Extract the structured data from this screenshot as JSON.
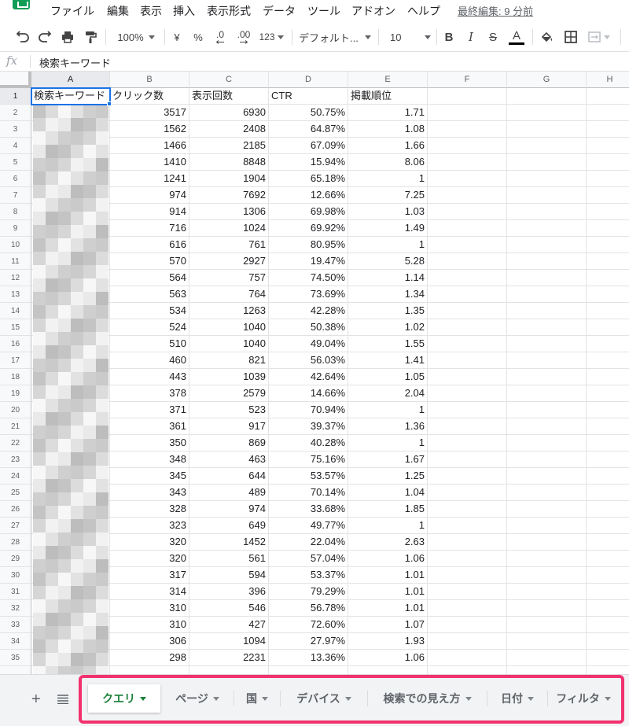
{
  "menu": {
    "items": [
      "ファイル",
      "編集",
      "表示",
      "挿入",
      "表示形式",
      "データ",
      "ツール",
      "アドオン",
      "ヘルプ"
    ],
    "last_edit": "最終編集: 9 分前"
  },
  "toolbar": {
    "zoom": "100%",
    "currency": "¥",
    "percent": "%",
    "decrease_decimal": ".0",
    "increase_decimal": ".00",
    "more_formats": "123",
    "font": "デフォルト...",
    "font_size": "10",
    "bold": "B",
    "italic": "I",
    "strikethrough": "S",
    "text_color_letter": "A"
  },
  "formula_bar": {
    "fx": "fx",
    "value": "検索キーワード"
  },
  "columns": [
    "A",
    "B",
    "C",
    "D",
    "E",
    "F",
    "G",
    "H"
  ],
  "table": {
    "headers": [
      "検索キーワード",
      "クリック数",
      "表示回数",
      "CTR",
      "掲載順位"
    ],
    "rows": [
      [
        "2",
        "",
        "3517",
        "6930",
        "50.75%",
        "1.71"
      ],
      [
        "3",
        "",
        "1562",
        "2408",
        "64.87%",
        "1.08"
      ],
      [
        "4",
        "",
        "1466",
        "2185",
        "67.09%",
        "1.66"
      ],
      [
        "5",
        "",
        "1410",
        "8848",
        "15.94%",
        "8.06"
      ],
      [
        "6",
        "",
        "1241",
        "1904",
        "65.18%",
        "1"
      ],
      [
        "7",
        "",
        "974",
        "7692",
        "12.66%",
        "7.25"
      ],
      [
        "8",
        "",
        "914",
        "1306",
        "69.98%",
        "1.03"
      ],
      [
        "9",
        "",
        "716",
        "1024",
        "69.92%",
        "1.49"
      ],
      [
        "10",
        "",
        "616",
        "761",
        "80.95%",
        "1"
      ],
      [
        "11",
        "",
        "570",
        "2927",
        "19.47%",
        "5.28"
      ],
      [
        "12",
        "",
        "564",
        "757",
        "74.50%",
        "1.14"
      ],
      [
        "13",
        "",
        "563",
        "764",
        "73.69%",
        "1.34"
      ],
      [
        "14",
        "",
        "534",
        "1263",
        "42.28%",
        "1.35"
      ],
      [
        "15",
        "",
        "524",
        "1040",
        "50.38%",
        "1.02"
      ],
      [
        "16",
        "",
        "510",
        "1040",
        "49.04%",
        "1.55"
      ],
      [
        "17",
        "",
        "460",
        "821",
        "56.03%",
        "1.41"
      ],
      [
        "18",
        "",
        "443",
        "1039",
        "42.64%",
        "1.05"
      ],
      [
        "19",
        "",
        "378",
        "2579",
        "14.66%",
        "2.04"
      ],
      [
        "20",
        "",
        "371",
        "523",
        "70.94%",
        "1"
      ],
      [
        "21",
        "",
        "361",
        "917",
        "39.37%",
        "1.36"
      ],
      [
        "22",
        "",
        "350",
        "869",
        "40.28%",
        "1"
      ],
      [
        "23",
        "",
        "348",
        "463",
        "75.16%",
        "1.67"
      ],
      [
        "24",
        "",
        "345",
        "644",
        "53.57%",
        "1.25"
      ],
      [
        "25",
        "",
        "343",
        "489",
        "70.14%",
        "1.04"
      ],
      [
        "26",
        "",
        "328",
        "974",
        "33.68%",
        "1.85"
      ],
      [
        "27",
        "",
        "323",
        "649",
        "49.77%",
        "1"
      ],
      [
        "28",
        "",
        "320",
        "1452",
        "22.04%",
        "2.63"
      ],
      [
        "29",
        "",
        "320",
        "561",
        "57.04%",
        "1.06"
      ],
      [
        "30",
        "",
        "317",
        "594",
        "53.37%",
        "1.01"
      ],
      [
        "31",
        "",
        "314",
        "396",
        "79.29%",
        "1.01"
      ],
      [
        "32",
        "",
        "310",
        "546",
        "56.78%",
        "1.01"
      ],
      [
        "33",
        "",
        "310",
        "427",
        "72.60%",
        "1.07"
      ],
      [
        "34",
        "",
        "306",
        "1094",
        "27.97%",
        "1.93"
      ],
      [
        "35",
        "",
        "298",
        "2231",
        "13.36%",
        "1.06"
      ]
    ]
  },
  "sheet_tabs": {
    "add_label": "+",
    "tabs": [
      "クエリ",
      "ページ",
      "国",
      "デバイス",
      "検索での見え方",
      "日付",
      "フィルタ"
    ]
  },
  "colors": {
    "accent_green": "#188038",
    "selection_blue": "#1a73e8",
    "highlight_pink": "#f2326f",
    "sheets_brand": "#0f9d58"
  }
}
